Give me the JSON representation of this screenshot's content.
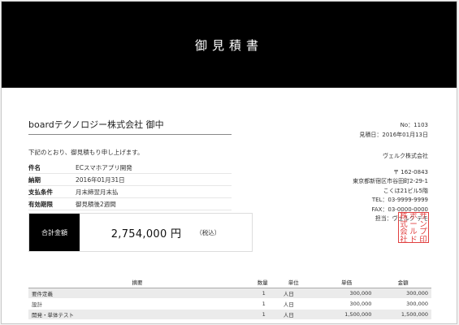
{
  "header": {
    "title": "御見積書"
  },
  "client": {
    "name": "boardテクノロジー株式会社 御中"
  },
  "meta": {
    "no": "No：1103",
    "issue_date": "見積日：2016年01月13日"
  },
  "intro": "下記のとおり、御見積もり申し上げます。",
  "details": [
    {
      "label": "件名",
      "value": "ECスマホアプリ開発"
    },
    {
      "label": "納期",
      "value": "2016年01月31日"
    },
    {
      "label": "支払条件",
      "value": "月末締翌月末払"
    },
    {
      "label": "有効期限",
      "value": "御見積後2週間"
    }
  ],
  "issuer": {
    "company": "ヴェルク株式会社",
    "postal": "〒 162-0843",
    "address1": "東京都新宿区市谷田町2-29-1",
    "address2": "こくほ21ビル5階",
    "tel": "TEL：03-9999-9999",
    "fax": "FAX：03-0000-0000",
    "contact": "担当：ヴェルク デモ"
  },
  "seal": {
    "chars": [
      "株",
      "ボ",
      "サ",
      "式",
      "ー",
      "ン",
      "会",
      "ル",
      "プ",
      "社",
      "ド",
      "印"
    ],
    "color": "#e04040"
  },
  "total": {
    "label": "合計金額",
    "amount": "2,754,000 円",
    "tax_note": "（税込）"
  },
  "table": {
    "headers": {
      "desc": "摘要",
      "qty": "数量",
      "unit": "単位",
      "price": "単価",
      "amount": "金額"
    },
    "rows": [
      {
        "desc": "要件定義",
        "qty": "1",
        "unit": "人日",
        "price": "300,000",
        "amount": "300,000"
      },
      {
        "desc": "設計",
        "qty": "1",
        "unit": "人日",
        "price": "300,000",
        "amount": "300,000"
      },
      {
        "desc": "開発・単体テスト",
        "qty": "1",
        "unit": "人日",
        "price": "1,500,000",
        "amount": "1,500,000"
      }
    ]
  }
}
